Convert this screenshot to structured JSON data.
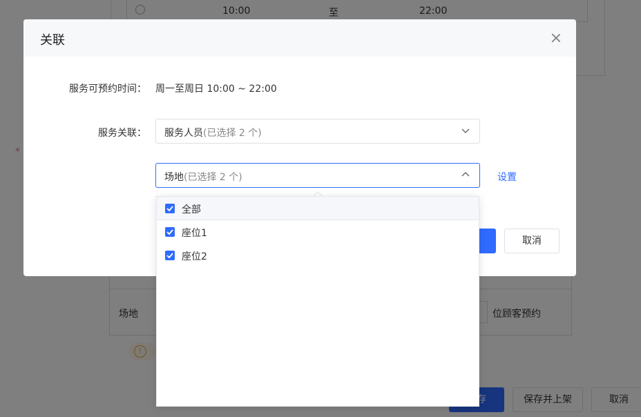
{
  "background": {
    "time_start": "10:00",
    "time_separator": "至",
    "time_end": "22:00",
    "required_mark": "*",
    "venue_label": "场地",
    "reserve_text": "位顾客预约",
    "save_label": "存",
    "save_publish_label": "保存并上架",
    "cancel_label": "取消"
  },
  "dialog": {
    "title": "关联",
    "time_label": "服务可预约时间：",
    "time_value": "周一至周日 10:00 ~ 22:00",
    "relation_label": "服务关联：",
    "staff_select": {
      "label": "服务人员",
      "count": "(已选择 2 个)"
    },
    "venue_select": {
      "label": "场地",
      "count": "(已选择 2 个)"
    },
    "settings_link": "设置",
    "cancel_label": "取消"
  },
  "dropdown": {
    "options": [
      {
        "label": "全部",
        "checked": true
      },
      {
        "label": "座位1",
        "checked": true
      },
      {
        "label": "座位2",
        "checked": true
      }
    ]
  },
  "colors": {
    "primary": "#2f6bff",
    "overlay": "rgba(0,0,0,0.5)"
  }
}
